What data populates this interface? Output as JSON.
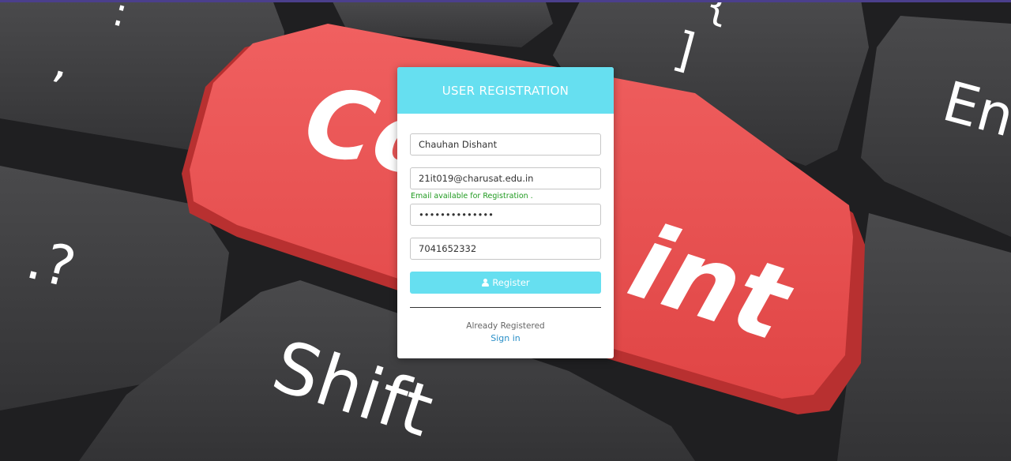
{
  "background": {
    "key_labels": [
      "Complaint",
      "Shift",
      "En",
      "?",
      "/",
      "]",
      "}",
      ";",
      ":"
    ],
    "accent_key_color": "#e94b4b"
  },
  "form": {
    "title": "USER REGISTRATION",
    "name_value": "Chauhan Dishant",
    "email_value": "21it019@charusat.edu.in",
    "email_status": "Email available for Registration .",
    "password_value": "••••••••••••••",
    "phone_value": "7041652332",
    "register_label": "Register",
    "register_icon": "user-icon",
    "already_text": "Already Registered",
    "signin_label": "Sign in",
    "colors": {
      "header": "#66dff0",
      "button": "#66dff0",
      "status": "#1f9a1f",
      "link": "#2a8fc8"
    }
  }
}
